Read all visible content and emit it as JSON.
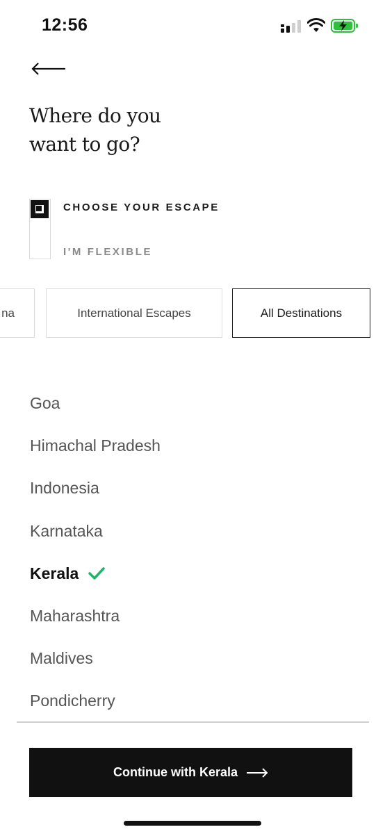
{
  "status_bar": {
    "time": "12:56",
    "icons": [
      "signal-icon",
      "wifi-icon",
      "battery-charging-icon"
    ],
    "battery_color": "#2fbf3f"
  },
  "header": {
    "back_icon": "arrow-left-icon",
    "title_line1": "Where do you",
    "title_line2": "want to go?"
  },
  "mode": {
    "options": [
      "CHOOSE YOUR ESCAPE",
      "I'M FLEXIBLE"
    ],
    "selected": "CHOOSE YOUR ESCAPE"
  },
  "tabs": [
    {
      "label": "na",
      "selected": false
    },
    {
      "label": "International Escapes",
      "selected": false
    },
    {
      "label": "All Destinations",
      "selected": true
    }
  ],
  "destinations": [
    {
      "name": "Goa",
      "selected": false
    },
    {
      "name": "Himachal Pradesh",
      "selected": false
    },
    {
      "name": "Indonesia",
      "selected": false
    },
    {
      "name": "Karnataka",
      "selected": false
    },
    {
      "name": "Kerala",
      "selected": true
    },
    {
      "name": "Maharashtra",
      "selected": false
    },
    {
      "name": "Maldives",
      "selected": false
    },
    {
      "name": "Pondicherry",
      "selected": false
    }
  ],
  "check_color": "#1fb36b",
  "cta": {
    "label": "Continue with Kerala",
    "icon": "arrow-right-icon"
  }
}
